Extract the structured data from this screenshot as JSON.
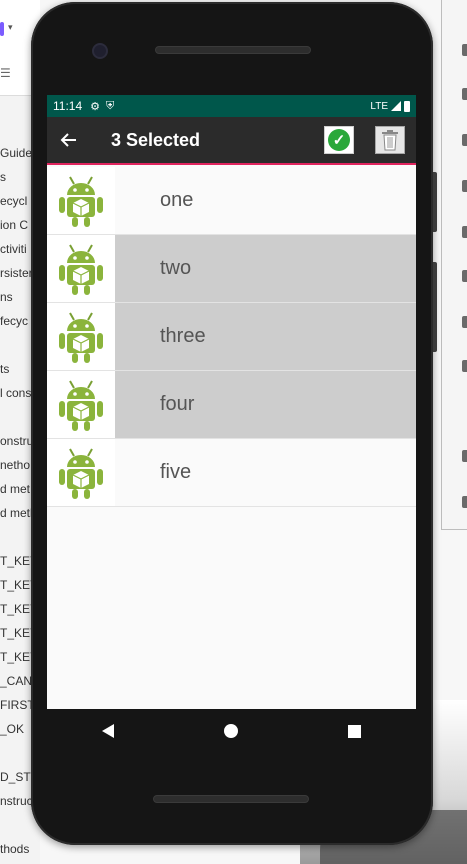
{
  "ide_sidebar_items": [
    "Guide",
    "s",
    "ecycl",
    "ion C",
    "ctiviti",
    "rsister",
    "ns",
    "fecyc",
    "ts",
    "l cons",
    "onstru",
    "netho",
    "d met",
    "d meth",
    "T_KEY",
    "T_KEY",
    "T_KEY",
    "T_KEY",
    "T_KEY",
    "_CANC",
    "FIRST",
    "_OK",
    "D_ST",
    "nstruc",
    "thods"
  ],
  "status_bar": {
    "time": "11:14",
    "network": "LTE"
  },
  "action_bar": {
    "title": "3 Selected"
  },
  "items": [
    {
      "label": "one",
      "selected": false
    },
    {
      "label": "two",
      "selected": true
    },
    {
      "label": "three",
      "selected": true
    },
    {
      "label": "four",
      "selected": true
    },
    {
      "label": "five",
      "selected": false
    }
  ],
  "colors": {
    "status_bar": "#00574b",
    "action_bar": "#2b2b2b",
    "accent_line": "#e0245e",
    "selected_row": "#cdcdcd",
    "android_green": "#8bb43c"
  },
  "icons": {
    "back": "arrow-left-icon",
    "confirm": "check-circle-icon",
    "delete": "trash-icon",
    "item": "android-robot-icon"
  }
}
